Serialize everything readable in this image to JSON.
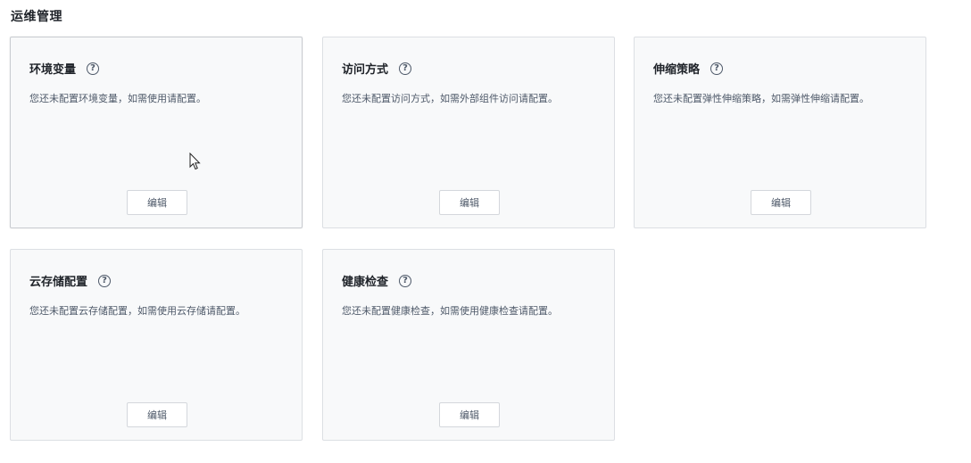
{
  "section": {
    "title": "运维管理"
  },
  "cards": [
    {
      "title": "环境变量",
      "description": "您还未配置环境变量，如需使用请配置。",
      "button_label": "编辑",
      "help_icon": "question-circle-icon"
    },
    {
      "title": "访问方式",
      "description": "您还未配置访问方式，如需外部组件访问请配置。",
      "button_label": "编辑",
      "help_icon": "question-circle-icon"
    },
    {
      "title": "伸缩策略",
      "description": "您还未配置弹性伸缩策略，如需弹性伸缩请配置。",
      "button_label": "编辑",
      "help_icon": "question-circle-icon"
    },
    {
      "title": "云存储配置",
      "description": "您还未配置云存储配置，如需使用云存储请配置。",
      "button_label": "编辑",
      "help_icon": "question-circle-icon"
    },
    {
      "title": "健康检查",
      "description": "您还未配置健康检查，如需使用健康检查请配置。",
      "button_label": "编辑",
      "help_icon": "question-circle-icon"
    }
  ],
  "colors": {
    "card_background": "#f8f9fa",
    "card_border": "#dcdfe3",
    "title_text": "#1f2329",
    "desc_text": "#4e5969"
  }
}
